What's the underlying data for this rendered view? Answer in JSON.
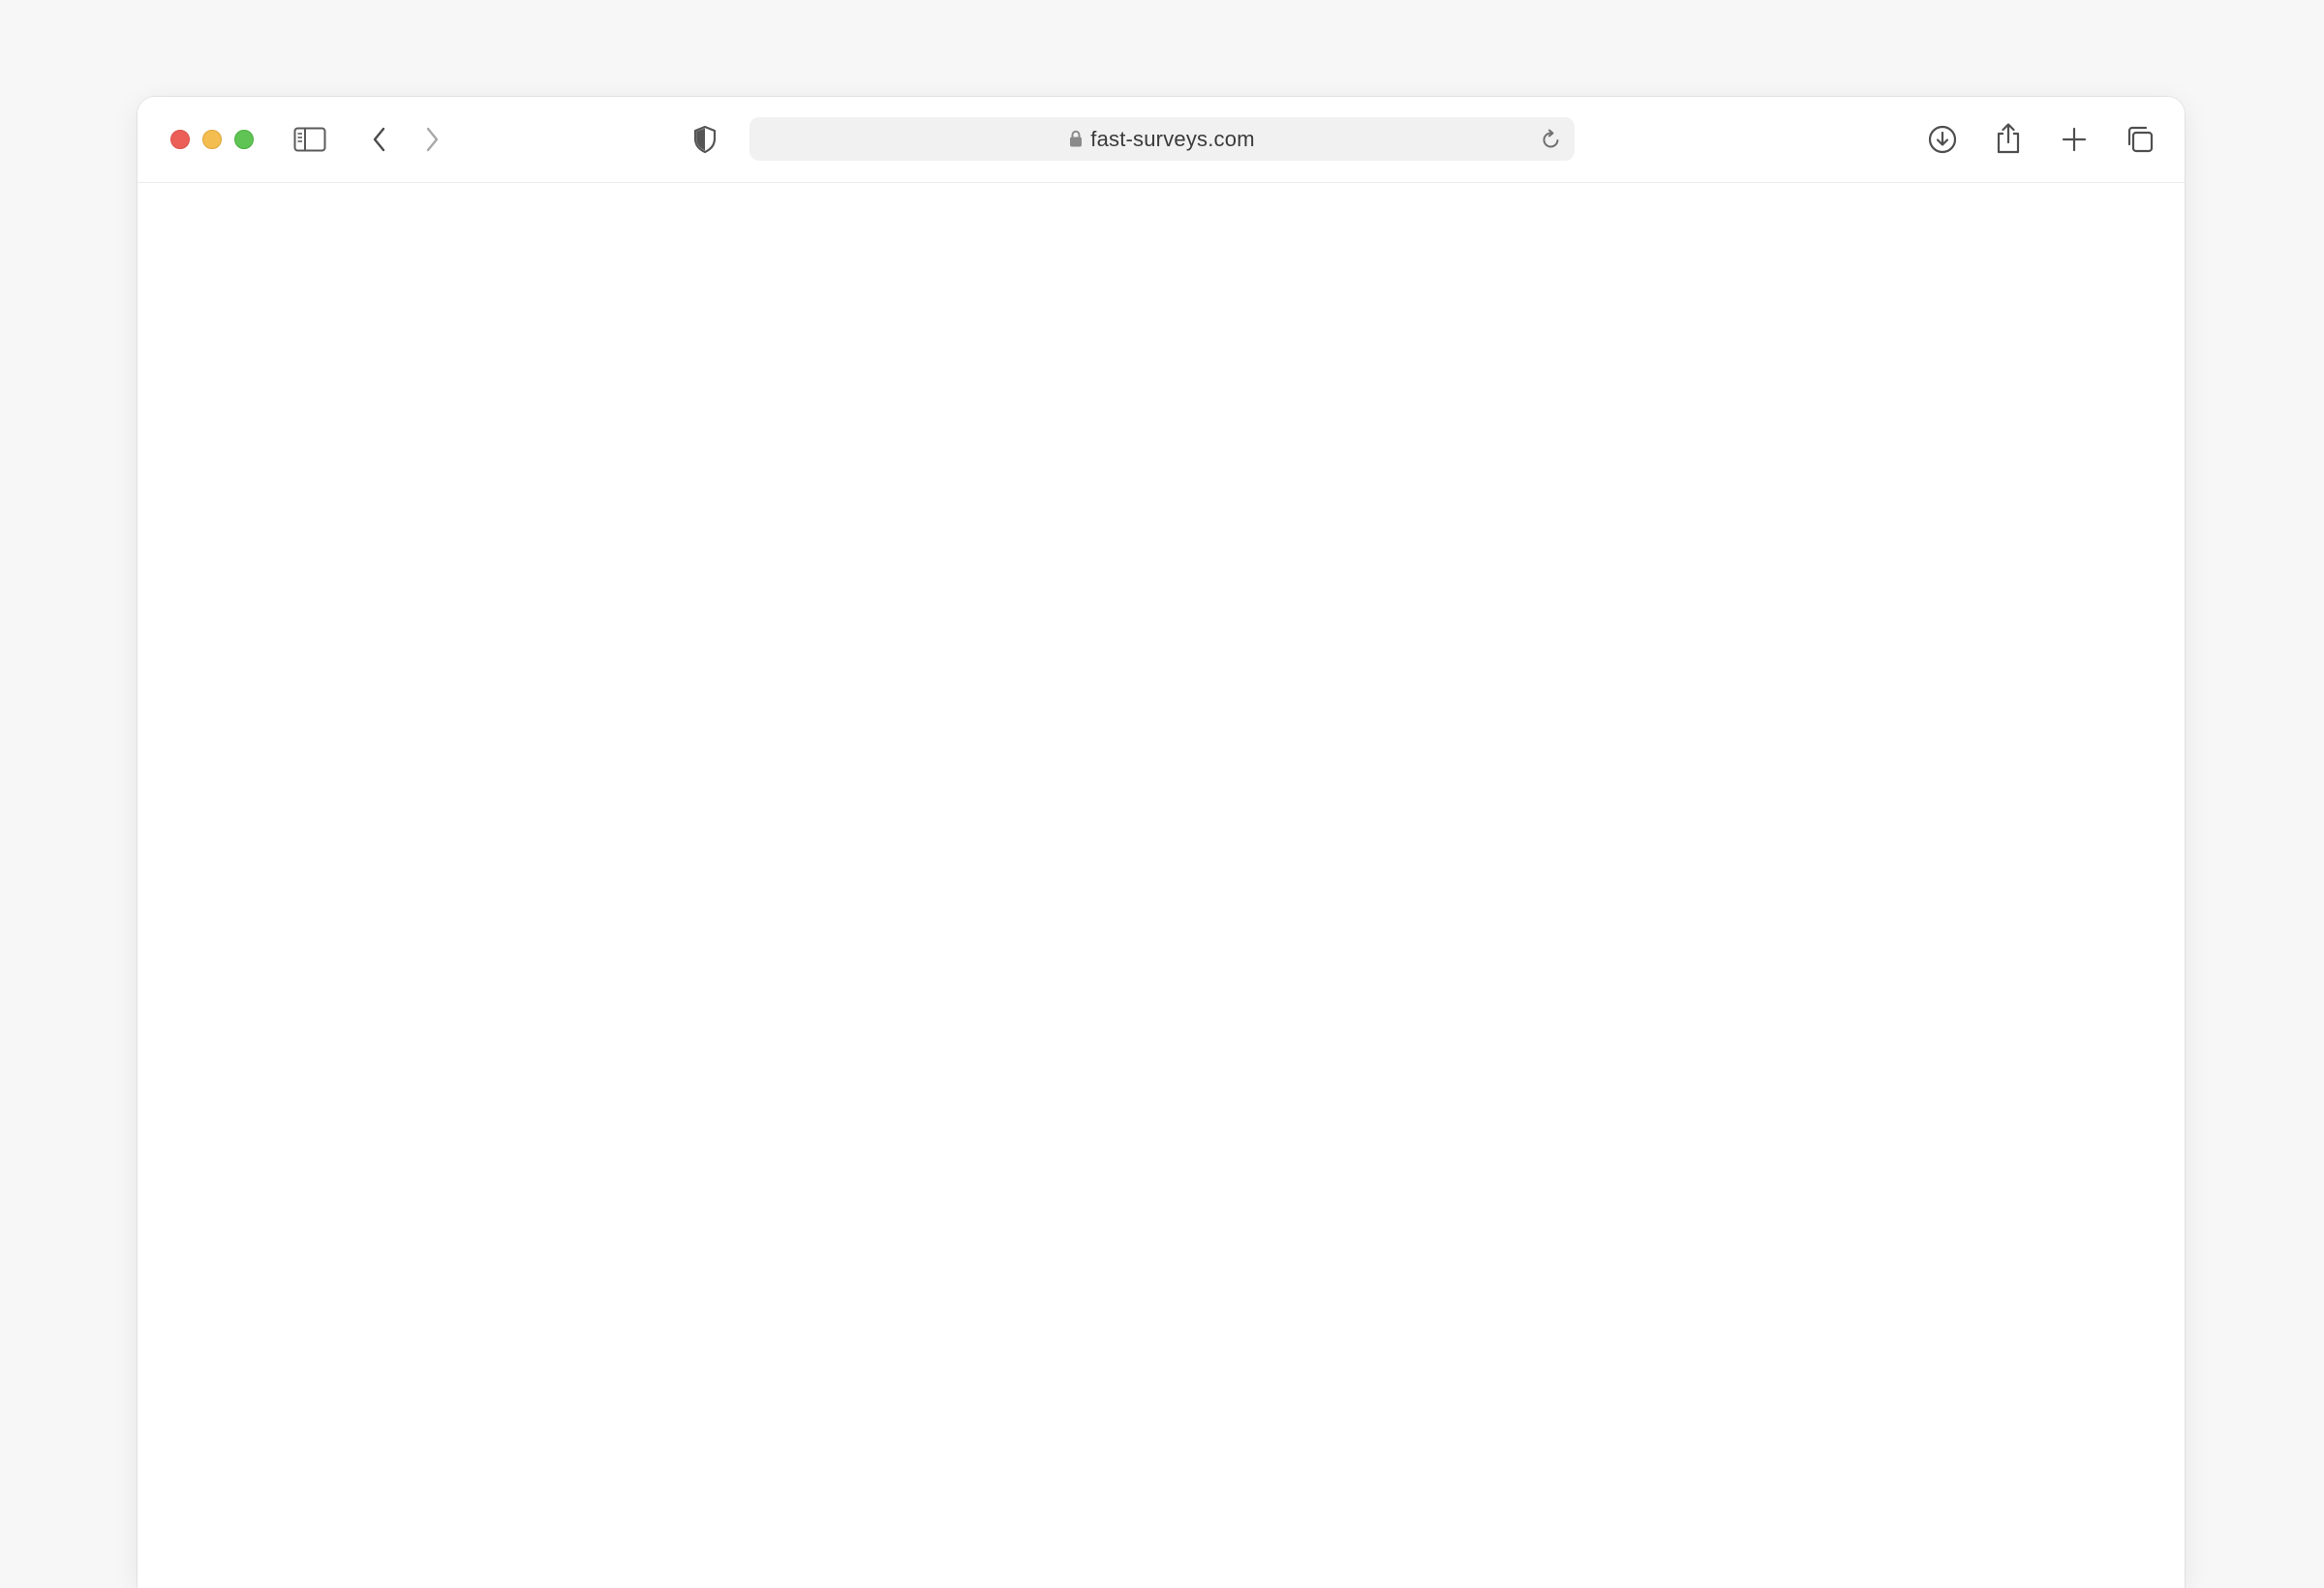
{
  "browser": {
    "url": "fast-surveys.com",
    "icons": {
      "sidebar": "sidebar-icon",
      "back": "chevron-left-icon",
      "forward": "chevron-right-icon",
      "privacy": "shield-icon",
      "lock": "lock-icon",
      "reload": "reload-icon",
      "downloads": "download-icon",
      "share": "share-icon",
      "new_tab": "plus-icon",
      "tabs": "tab-overview-icon"
    },
    "colors": {
      "close": "#ec5f58",
      "minimize": "#f4bd4f",
      "maximize": "#5fc453"
    }
  }
}
